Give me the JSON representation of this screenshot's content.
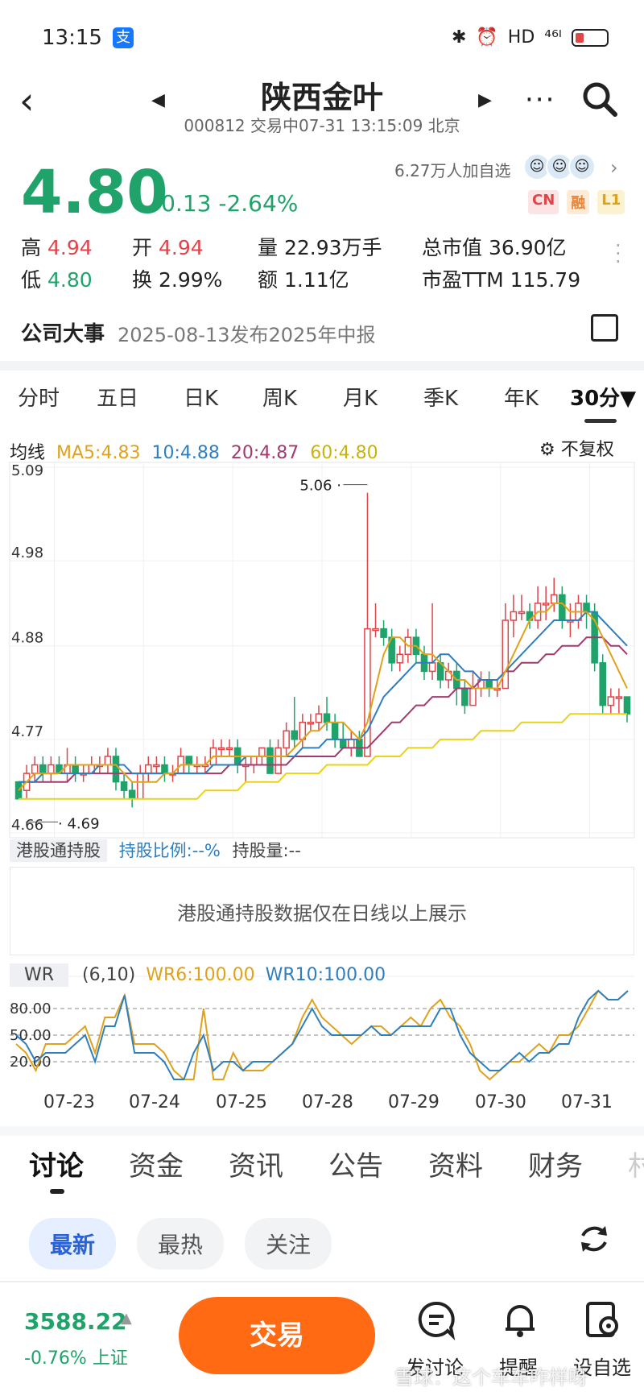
{
  "status_bar": {
    "time": "13:15",
    "alipay_icon": "支",
    "right": [
      "✱",
      "⏰",
      "HD",
      "⁴⁶ᴵ"
    ]
  },
  "header": {
    "title": "陕西金叶",
    "subtitle": "000812 交易中07-31 13:15:09 北京"
  },
  "quote": {
    "price": "4.80",
    "change": "-0.13 -2.64%",
    "followers": "6.27万人加自选",
    "badges": [
      "CN",
      "融",
      "L1"
    ]
  },
  "stats": {
    "high_label": "高",
    "high": "4.94",
    "open_label": "开",
    "open": "4.94",
    "volume_label": "量",
    "volume": "22.93万手",
    "mktcap_label": "总市值",
    "mktcap": "36.90亿",
    "low_label": "低",
    "low": "4.80",
    "turnover_label": "换",
    "turnover": "2.99%",
    "amount_label": "额",
    "amount": "1.11亿",
    "pe_label": "市盈TTM",
    "pe": "115.79"
  },
  "event": {
    "title": "公司大事",
    "text": "2025-08-13发布2025年中报"
  },
  "period_tabs": [
    "分时",
    "五日",
    "日K",
    "周K",
    "月K",
    "季K",
    "年K",
    "30分▼"
  ],
  "ma": {
    "label": "均线",
    "ma5": "MA5:4.83",
    "ma10": "10:4.88",
    "ma20": "20:4.87",
    "ma60": "60:4.80",
    "fq": "不复权",
    "colors": {
      "ma5": "#e0a21a",
      "ma10": "#2f7fbf",
      "ma20": "#a23a6e",
      "ma60": "#e8d21a",
      "up": "#e0454a",
      "down": "#1fa36b"
    }
  },
  "chart_data": [
    {
      "type": "candlestick",
      "y_ticks": [
        "5.09",
        "4.98",
        "4.88",
        "4.77",
        "4.66"
      ],
      "ylim": [
        4.66,
        5.09
      ],
      "high_marker": "5.06",
      "low_marker": "4.69",
      "x_dates": [
        "07-23",
        "07-24",
        "07-25",
        "07-28",
        "07-29",
        "07-30",
        "07-31"
      ],
      "candles": [
        [
          4.72,
          4.7,
          4.72,
          4.7
        ],
        [
          4.71,
          4.73,
          4.74,
          4.7
        ],
        [
          4.73,
          4.74,
          4.75,
          4.72
        ],
        [
          4.74,
          4.73,
          4.75,
          4.72
        ],
        [
          4.73,
          4.74,
          4.75,
          4.72
        ],
        [
          4.74,
          4.73,
          4.75,
          4.73
        ],
        [
          4.73,
          4.74,
          4.76,
          4.72
        ],
        [
          4.74,
          4.73,
          4.75,
          4.72
        ],
        [
          4.73,
          4.73,
          4.74,
          4.72
        ],
        [
          4.73,
          4.74,
          4.75,
          4.73
        ],
        [
          4.74,
          4.74,
          4.75,
          4.73
        ],
        [
          4.74,
          4.75,
          4.76,
          4.73
        ],
        [
          4.75,
          4.72,
          4.76,
          4.71
        ],
        [
          4.72,
          4.71,
          4.73,
          4.7
        ],
        [
          4.71,
          4.7,
          4.72,
          4.69
        ],
        [
          4.7,
          4.73,
          4.74,
          4.7
        ],
        [
          4.73,
          4.74,
          4.75,
          4.72
        ],
        [
          4.74,
          4.74,
          4.75,
          4.73
        ],
        [
          4.74,
          4.73,
          4.75,
          4.72
        ],
        [
          4.73,
          4.73,
          4.74,
          4.72
        ],
        [
          4.73,
          4.75,
          4.76,
          4.73
        ],
        [
          4.75,
          4.74,
          4.75,
          4.73
        ],
        [
          4.74,
          4.74,
          4.75,
          4.73
        ],
        [
          4.74,
          4.74,
          4.75,
          4.73
        ],
        [
          4.74,
          4.76,
          4.77,
          4.74
        ],
        [
          4.76,
          4.76,
          4.77,
          4.75
        ],
        [
          4.76,
          4.76,
          4.77,
          4.75
        ],
        [
          4.76,
          4.74,
          4.77,
          4.73
        ],
        [
          4.74,
          4.74,
          4.75,
          4.72
        ],
        [
          4.74,
          4.75,
          4.75,
          4.73
        ],
        [
          4.75,
          4.76,
          4.76,
          4.74
        ],
        [
          4.76,
          4.73,
          4.77,
          4.73
        ],
        [
          4.73,
          4.76,
          4.77,
          4.73
        ],
        [
          4.76,
          4.78,
          4.79,
          4.75
        ],
        [
          4.78,
          4.77,
          4.82,
          4.76
        ],
        [
          4.77,
          4.79,
          4.8,
          4.76
        ],
        [
          4.79,
          4.79,
          4.8,
          4.78
        ],
        [
          4.79,
          4.8,
          4.81,
          4.78
        ],
        [
          4.8,
          4.79,
          4.82,
          4.78
        ],
        [
          4.79,
          4.77,
          4.8,
          4.76
        ],
        [
          4.77,
          4.76,
          4.79,
          4.76
        ],
        [
          4.76,
          4.77,
          4.78,
          4.75
        ],
        [
          4.77,
          4.75,
          4.78,
          4.75
        ],
        [
          4.75,
          4.9,
          5.06,
          4.75
        ],
        [
          4.9,
          4.9,
          4.93,
          4.89
        ],
        [
          4.9,
          4.89,
          4.91,
          4.88
        ],
        [
          4.89,
          4.86,
          4.9,
          4.85
        ],
        [
          4.86,
          4.87,
          4.88,
          4.85
        ],
        [
          4.87,
          4.89,
          4.9,
          4.86
        ],
        [
          4.89,
          4.87,
          4.9,
          4.86
        ],
        [
          4.87,
          4.85,
          4.88,
          4.84
        ],
        [
          4.85,
          4.86,
          4.93,
          4.84
        ],
        [
          4.86,
          4.84,
          4.87,
          4.83
        ],
        [
          4.84,
          4.85,
          4.86,
          4.83
        ],
        [
          4.85,
          4.83,
          4.86,
          4.81
        ],
        [
          4.83,
          4.81,
          4.84,
          4.8
        ],
        [
          4.81,
          4.83,
          4.85,
          4.81
        ],
        [
          4.83,
          4.84,
          4.85,
          4.82
        ],
        [
          4.84,
          4.83,
          4.85,
          4.82
        ],
        [
          4.83,
          4.83,
          4.84,
          4.82
        ],
        [
          4.83,
          4.91,
          4.93,
          4.83
        ],
        [
          4.91,
          4.92,
          4.94,
          4.89
        ],
        [
          4.92,
          4.92,
          4.94,
          4.91
        ],
        [
          4.92,
          4.91,
          4.93,
          4.9
        ],
        [
          4.91,
          4.93,
          4.95,
          4.9
        ],
        [
          4.93,
          4.93,
          4.95,
          4.91
        ],
        [
          4.93,
          4.94,
          4.96,
          4.92
        ],
        [
          4.94,
          4.91,
          4.95,
          4.9
        ],
        [
          4.91,
          4.91,
          4.93,
          4.89
        ],
        [
          4.91,
          4.93,
          4.94,
          4.9
        ],
        [
          4.93,
          4.92,
          4.94,
          4.9
        ],
        [
          4.92,
          4.86,
          4.93,
          4.85
        ],
        [
          4.86,
          4.81,
          4.87,
          4.8
        ],
        [
          4.81,
          4.82,
          4.83,
          4.8
        ],
        [
          4.82,
          4.82,
          4.83,
          4.8
        ],
        [
          4.82,
          4.8,
          4.82,
          4.79
        ]
      ],
      "ma5": [
        4.71,
        4.72,
        4.73,
        4.73,
        4.73,
        4.73,
        4.74,
        4.74,
        4.74,
        4.74,
        4.74,
        4.74,
        4.74,
        4.73,
        4.72,
        4.72,
        4.72,
        4.72,
        4.73,
        4.73,
        4.74,
        4.74,
        4.74,
        4.74,
        4.75,
        4.75,
        4.75,
        4.75,
        4.75,
        4.75,
        4.75,
        4.75,
        4.75,
        4.75,
        4.76,
        4.77,
        4.78,
        4.78,
        4.79,
        4.79,
        4.79,
        4.78,
        4.77,
        4.79,
        4.83,
        4.87,
        4.89,
        4.89,
        4.88,
        4.88,
        4.87,
        4.87,
        4.86,
        4.85,
        4.84,
        4.84,
        4.83,
        4.83,
        4.83,
        4.83,
        4.85,
        4.87,
        4.89,
        4.91,
        4.92,
        4.92,
        4.93,
        4.93,
        4.92,
        4.92,
        4.92,
        4.91,
        4.89,
        4.87,
        4.85,
        4.83
      ],
      "ma10": [
        4.72,
        4.72,
        4.72,
        4.73,
        4.73,
        4.73,
        4.73,
        4.73,
        4.73,
        4.73,
        4.74,
        4.74,
        4.74,
        4.74,
        4.73,
        4.73,
        4.73,
        4.73,
        4.73,
        4.73,
        4.73,
        4.73,
        4.73,
        4.73,
        4.74,
        4.74,
        4.74,
        4.74,
        4.75,
        4.75,
        4.75,
        4.75,
        4.75,
        4.75,
        4.75,
        4.76,
        4.76,
        4.76,
        4.77,
        4.77,
        4.77,
        4.77,
        4.77,
        4.78,
        4.8,
        4.82,
        4.83,
        4.84,
        4.85,
        4.86,
        4.86,
        4.86,
        4.87,
        4.87,
        4.86,
        4.85,
        4.85,
        4.84,
        4.84,
        4.84,
        4.85,
        4.86,
        4.87,
        4.88,
        4.89,
        4.9,
        4.91,
        4.91,
        4.91,
        4.91,
        4.92,
        4.92,
        4.91,
        4.9,
        4.89,
        4.88
      ],
      "ma20": [
        4.72,
        4.72,
        4.72,
        4.72,
        4.72,
        4.72,
        4.72,
        4.73,
        4.73,
        4.73,
        4.73,
        4.73,
        4.73,
        4.73,
        4.73,
        4.73,
        4.73,
        4.73,
        4.73,
        4.73,
        4.73,
        4.73,
        4.73,
        4.73,
        4.73,
        4.73,
        4.74,
        4.74,
        4.74,
        4.74,
        4.74,
        4.74,
        4.74,
        4.74,
        4.75,
        4.75,
        4.75,
        4.75,
        4.75,
        4.75,
        4.76,
        4.76,
        4.76,
        4.76,
        4.77,
        4.78,
        4.79,
        4.79,
        4.8,
        4.81,
        4.81,
        4.82,
        4.82,
        4.82,
        4.83,
        4.83,
        4.83,
        4.84,
        4.84,
        4.84,
        4.85,
        4.85,
        4.86,
        4.86,
        4.86,
        4.87,
        4.87,
        4.88,
        4.88,
        4.88,
        4.89,
        4.89,
        4.89,
        4.88,
        4.88,
        4.87
      ],
      "ma60": [
        4.7,
        4.7,
        4.7,
        4.7,
        4.7,
        4.7,
        4.7,
        4.7,
        4.7,
        4.7,
        4.7,
        4.7,
        4.7,
        4.7,
        4.7,
        4.7,
        4.7,
        4.7,
        4.7,
        4.7,
        4.7,
        4.7,
        4.7,
        4.71,
        4.71,
        4.71,
        4.71,
        4.71,
        4.72,
        4.72,
        4.72,
        4.72,
        4.72,
        4.73,
        4.73,
        4.73,
        4.73,
        4.73,
        4.74,
        4.74,
        4.74,
        4.74,
        4.74,
        4.74,
        4.75,
        4.75,
        4.75,
        4.75,
        4.76,
        4.76,
        4.76,
        4.76,
        4.77,
        4.77,
        4.77,
        4.77,
        4.77,
        4.78,
        4.78,
        4.78,
        4.78,
        4.78,
        4.79,
        4.79,
        4.79,
        4.79,
        4.79,
        4.79,
        4.8,
        4.8,
        4.8,
        4.8,
        4.8,
        4.8,
        4.8,
        4.8
      ]
    },
    {
      "type": "line",
      "y_ticks": [
        "80.00",
        "50.00",
        "20.00"
      ],
      "ylim": [
        0,
        100
      ],
      "series": [
        {
          "name": "WR6:100.00",
          "values": [
            40,
            30,
            10,
            40,
            40,
            40,
            50,
            60,
            30,
            70,
            70,
            95,
            40,
            40,
            40,
            30,
            10,
            0,
            0,
            80,
            0,
            0,
            30,
            10,
            10,
            10,
            20,
            30,
            40,
            70,
            90,
            70,
            60,
            50,
            40,
            50,
            60,
            60,
            50,
            60,
            70,
            60,
            80,
            90,
            70,
            60,
            40,
            10,
            0,
            10,
            20,
            20,
            30,
            40,
            30,
            50,
            50,
            60,
            80,
            100,
            90,
            90,
            100
          ]
        },
        {
          "name": "WR10:100.00",
          "values": [
            50,
            40,
            20,
            30,
            30,
            30,
            40,
            50,
            20,
            60,
            60,
            95,
            30,
            30,
            30,
            20,
            0,
            0,
            30,
            50,
            10,
            20,
            20,
            10,
            20,
            20,
            20,
            30,
            40,
            60,
            80,
            60,
            50,
            50,
            50,
            50,
            60,
            50,
            50,
            60,
            60,
            60,
            60,
            80,
            80,
            50,
            30,
            20,
            10,
            10,
            20,
            30,
            20,
            30,
            30,
            40,
            40,
            70,
            90,
            100,
            90,
            90,
            100
          ]
        }
      ],
      "params": "(6,10)",
      "label": "WR"
    }
  ],
  "hk": {
    "tag": "港股通持股",
    "ratio": "持股比例:--%",
    "amount": "持股量:--",
    "note": "港股通持股数据仅在日线以上展示"
  },
  "sub_tabs": [
    "讨论",
    "资金",
    "资讯",
    "公告",
    "资料",
    "财务",
    "村"
  ],
  "filters": [
    "最新",
    "最热",
    "关注"
  ],
  "bottom": {
    "index_value": "3588.22",
    "index_change": "-0.76% 上证",
    "trade": "交易",
    "discuss": "发讨论",
    "remind": "提醒",
    "watchlist": "设自选"
  },
  "watermark": "雪球：这个车车咋样呀"
}
